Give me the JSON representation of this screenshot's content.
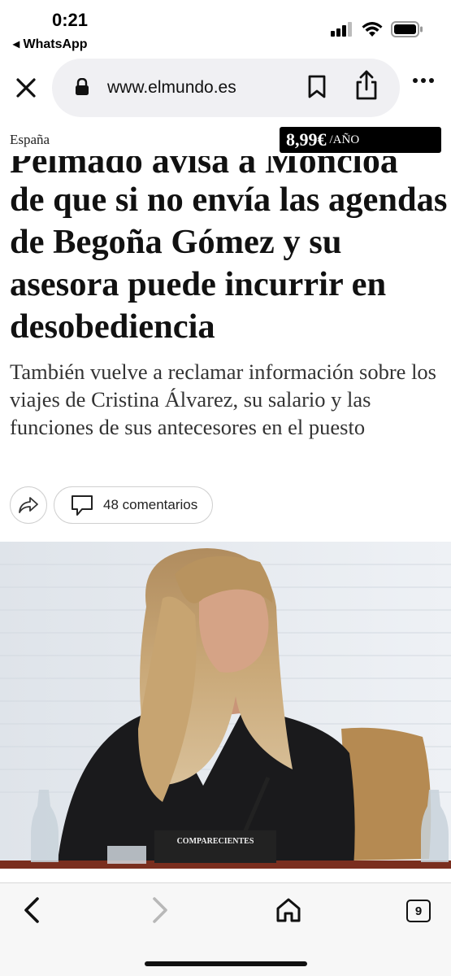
{
  "status_bar": {
    "time": "0:21",
    "back_app": "◂ WhatsApp"
  },
  "browser": {
    "url": "www.elmundo.es",
    "tab_count": "9"
  },
  "site": {
    "section": "España",
    "promo_price": "8,99€",
    "promo_period": "/AÑO"
  },
  "article": {
    "headline_cut_line": "Pelmado avisa a Moncloa",
    "headline": "de que si no envía las agendas de Begoña Gómez y su asesora puede incurrir en desobediencia",
    "subhead": "También vuelve a reclamar información sobre los viajes de Cristina Álvarez, su salario y las funciones de sus antecesores en el puesto",
    "comments_label": "48 comentarios"
  },
  "photo": {
    "placard_text": "COMPARECIENTES"
  },
  "colors": {
    "accent_black": "#000000",
    "pill_bg": "#f0f0f3",
    "toolbar_bg": "#f7f7f7"
  }
}
